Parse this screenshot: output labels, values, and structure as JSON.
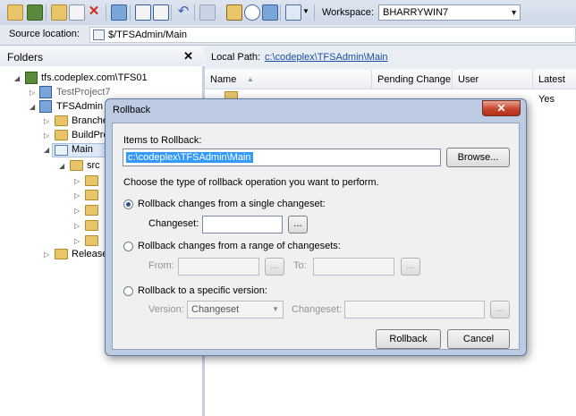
{
  "toolbar": {
    "workspace_label": "Workspace:",
    "workspace_value": "BHARRYWIN7"
  },
  "source": {
    "label": "Source location:",
    "value": "$/TFSAdmin/Main"
  },
  "folders": {
    "title": "Folders",
    "close": "✕",
    "items": [
      "tfs.codeplex.com\\TFS01",
      "TestProject7",
      "TFSAdmin",
      "Branches",
      "BuildPro",
      "Main",
      "src",
      "Release"
    ]
  },
  "local": {
    "label": "Local Path:",
    "path": "c:\\codeplex\\TFSAdmin\\Main"
  },
  "list": {
    "columns": [
      "Name",
      "Pending Change",
      "User",
      "Latest"
    ],
    "row_latest": "Yes"
  },
  "dialog": {
    "title": "Rollback",
    "close": "✕",
    "items_label": "Items to Rollback:",
    "items_value": "c:\\codeplex\\TFSAdmin\\Main",
    "browse": "Browse...",
    "instruction": "Choose the type of rollback operation you want to perform.",
    "opt_single": "Rollback changes from a single changeset:",
    "changeset_label": "Changeset:",
    "ellipsis": "...",
    "opt_range": "Rollback changes from a range of changesets:",
    "from_label": "From:",
    "to_label": "To:",
    "opt_version": "Rollback to a specific version:",
    "version_label": "Version:",
    "version_value": "Changeset",
    "changeset2_label": "Changeset:",
    "rollback_btn": "Rollback",
    "cancel_btn": "Cancel"
  },
  "colors": {
    "accent": "#1c4fa6",
    "selection": "#3399ff",
    "dialog_frame": "#bccbe2"
  }
}
